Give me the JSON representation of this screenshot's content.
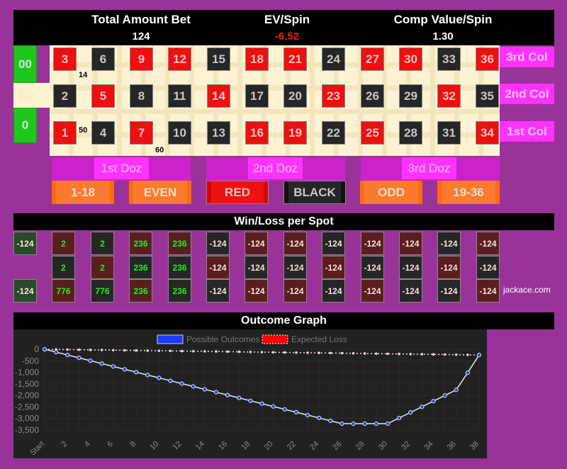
{
  "header": {
    "total_amount_bet_label": "Total Amount Bet",
    "total_amount_bet": "124",
    "ev_spin_label": "EV/Spin",
    "ev_spin": "-6.52",
    "comp_value_label": "Comp Value/Spin",
    "comp_value": "1.30",
    "ev_color": "#ff1a1a"
  },
  "board": {
    "zeros": [
      "00",
      "0"
    ],
    "rows": [
      [
        {
          "n": "3",
          "c": "r"
        },
        {
          "n": "6",
          "c": "b"
        },
        {
          "n": "9",
          "c": "r"
        },
        {
          "n": "12",
          "c": "r"
        },
        {
          "n": "15",
          "c": "b"
        },
        {
          "n": "18",
          "c": "r"
        },
        {
          "n": "21",
          "c": "r"
        },
        {
          "n": "24",
          "c": "b"
        },
        {
          "n": "27",
          "c": "r"
        },
        {
          "n": "30",
          "c": "r"
        },
        {
          "n": "33",
          "c": "b"
        },
        {
          "n": "36",
          "c": "r"
        }
      ],
      [
        {
          "n": "2",
          "c": "b"
        },
        {
          "n": "5",
          "c": "r"
        },
        {
          "n": "8",
          "c": "b"
        },
        {
          "n": "11",
          "c": "b"
        },
        {
          "n": "14",
          "c": "r"
        },
        {
          "n": "17",
          "c": "b"
        },
        {
          "n": "20",
          "c": "b"
        },
        {
          "n": "23",
          "c": "r"
        },
        {
          "n": "26",
          "c": "b"
        },
        {
          "n": "29",
          "c": "b"
        },
        {
          "n": "32",
          "c": "r"
        },
        {
          "n": "35",
          "c": "b"
        }
      ],
      [
        {
          "n": "1",
          "c": "r"
        },
        {
          "n": "4",
          "c": "b"
        },
        {
          "n": "7",
          "c": "r"
        },
        {
          "n": "10",
          "c": "b"
        },
        {
          "n": "13",
          "c": "b"
        },
        {
          "n": "16",
          "c": "r"
        },
        {
          "n": "19",
          "c": "r"
        },
        {
          "n": "22",
          "c": "b"
        },
        {
          "n": "25",
          "c": "r"
        },
        {
          "n": "28",
          "c": "b"
        },
        {
          "n": "31",
          "c": "b"
        },
        {
          "n": "34",
          "c": "r"
        }
      ]
    ],
    "chips": [
      {
        "label": "14",
        "position": "split 3/6 corner area"
      },
      {
        "label": "50",
        "position": "split 1/4"
      },
      {
        "label": "60",
        "position": "street 7-12 line"
      }
    ],
    "column_bets": [
      "3rd Col",
      "2nd Col",
      "1st Col"
    ],
    "dozens": [
      "1st Doz",
      "2nd Doz",
      "3rd Doz"
    ],
    "even_money": [
      "1-18",
      "EVEN",
      "RED",
      "BLACK",
      "ODD",
      "19-36"
    ]
  },
  "win_loss": {
    "title": "Win/Loss per Spot",
    "zeros": [
      {
        "spot": "00",
        "value": "-124"
      },
      {
        "spot": "0",
        "value": "-124"
      }
    ],
    "rows": [
      [
        "2",
        "2",
        "236",
        "236",
        "-124",
        "-124",
        "-124",
        "-124",
        "-124",
        "-124",
        "-124",
        "-124"
      ],
      [
        "2",
        "2",
        "236",
        "236",
        "-124",
        "-124",
        "-124",
        "-124",
        "-124",
        "-124",
        "-124",
        "-124"
      ],
      [
        "776",
        "776",
        "236",
        "236",
        "-124",
        "-124",
        "-124",
        "-124",
        "-124",
        "-124",
        "-124",
        "-124"
      ]
    ],
    "site": "jackace.com"
  },
  "outcome_graph": {
    "title": "Outcome Graph"
  },
  "chart_data": {
    "type": "line",
    "title": "Outcome Graph",
    "legend": [
      "Possible Outcomes",
      "Expected Loss"
    ],
    "legend_position": "top-center",
    "x_tick_labels": [
      "Start",
      "2",
      "4",
      "6",
      "8",
      "10",
      "12",
      "14",
      "16",
      "18",
      "20",
      "22",
      "24",
      "26",
      "28",
      "30",
      "32",
      "34",
      "36",
      "38"
    ],
    "y_tick_labels": [
      "0",
      "-500",
      "-1,000",
      "-1,500",
      "-2,000",
      "-2,500",
      "-3,000",
      "-3,500"
    ],
    "ylim": [
      -3500,
      0
    ],
    "xlim": [
      0,
      38
    ],
    "grid": true,
    "series": [
      {
        "name": "Possible Outcomes",
        "color": "#1a3cff",
        "values": [
          0,
          -124,
          -248,
          -372,
          -496,
          -620,
          -744,
          -868,
          -992,
          -1116,
          -1240,
          -1364,
          -1488,
          -1612,
          -1736,
          -1860,
          -1984,
          -2108,
          -2232,
          -2356,
          -2480,
          -2604,
          -2728,
          -2852,
          -2976,
          -3100,
          -3224,
          -3224,
          -3224,
          -3224,
          -3224,
          -2980,
          -2736,
          -2492,
          -2248,
          -2004,
          -1760,
          -1016,
          -248
        ]
      },
      {
        "name": "Expected Loss",
        "color": "#ff0000",
        "values": [
          0,
          -6.52,
          -13.04,
          -19.56,
          -26.08,
          -32.6,
          -39.12,
          -45.64,
          -52.16,
          -58.68,
          -65.2,
          -71.72,
          -78.24,
          -84.76,
          -91.28,
          -97.8,
          -104.32,
          -110.84,
          -117.36,
          -123.88,
          -130.4,
          -136.92,
          -143.44,
          -149.96,
          -156.48,
          -163,
          -169.52,
          -176.04,
          -182.56,
          -189.08,
          -195.6,
          -202.12,
          -208.64,
          -215.16,
          -221.68,
          -228.2,
          -234.72,
          -241.24,
          -247.76
        ]
      }
    ]
  }
}
